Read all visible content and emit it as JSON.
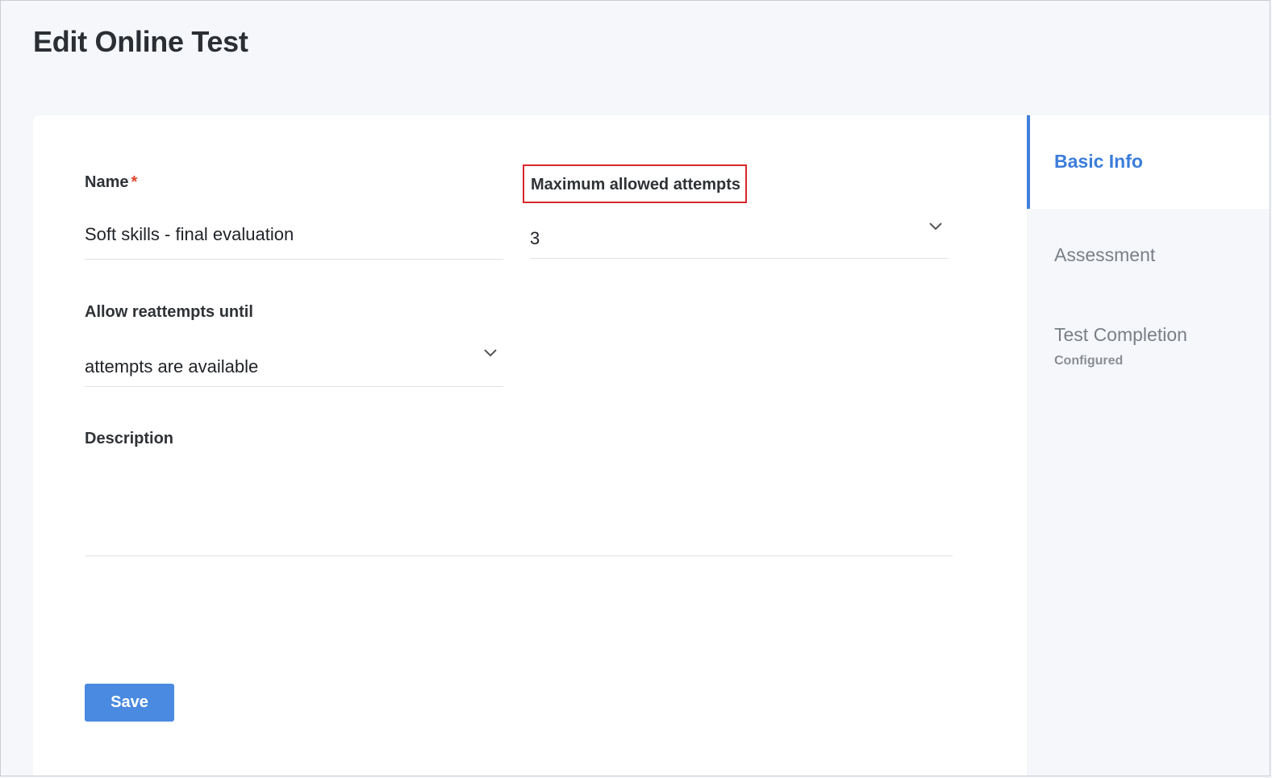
{
  "page": {
    "title": "Edit Online Test"
  },
  "form": {
    "name": {
      "label": "Name",
      "required_mark": "*",
      "value": "Soft skills - final evaluation"
    },
    "max_attempts": {
      "label": "Maximum allowed attempts",
      "value": "3"
    },
    "reattempts": {
      "label": "Allow reattempts until",
      "value": "attempts are available"
    },
    "description": {
      "label": "Description",
      "value": ""
    },
    "save_label": "Save"
  },
  "sidebar": {
    "items": [
      {
        "label": "Basic Info",
        "status": ""
      },
      {
        "label": "Assessment",
        "status": ""
      },
      {
        "label": "Test Completion",
        "status": "Configured"
      }
    ]
  },
  "colors": {
    "accent": "#3b7ddb",
    "save_button": "#4a8ae0",
    "highlight": "#d9262c",
    "required": "#e0412b"
  },
  "icons": {
    "dropdown": "chevron-down-icon"
  }
}
